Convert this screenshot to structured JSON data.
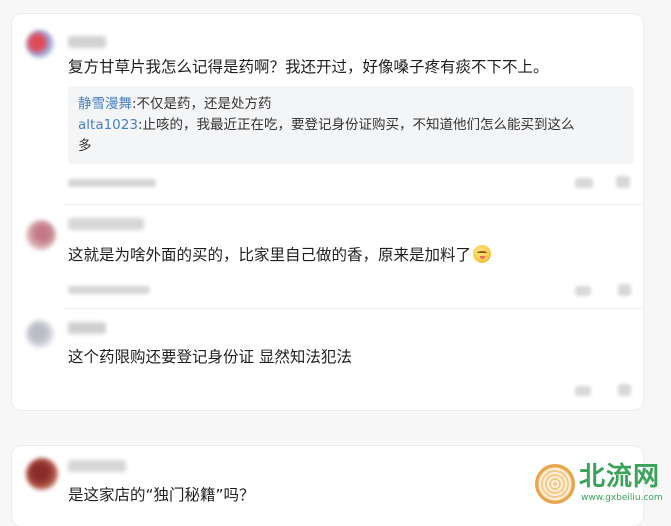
{
  "comments": [
    {
      "text": "复方甘草片我怎么记得是药啊？我还开过，好像嗓子疼有痰不下不上。",
      "replies": [
        {
          "name": "静雪漫舞",
          "text": ":不仅是药，还是处方药"
        },
        {
          "name": "alta1023",
          "text": ":止咳的，我最近正在吃，要登记身份证购买，不知道他们怎么能买到这么"
        },
        {
          "name": "",
          "text": "多"
        }
      ]
    },
    {
      "text": "这就是为啥外面的买的，比家里自己做的香，原来是加料了",
      "emoji_icon": "drooling-face-emoji-icon"
    },
    {
      "text": "这个药限购还要登记身份证 显然知法犯法"
    },
    {
      "text": "是这家店的“独门秘籍”吗？"
    }
  ],
  "watermark": {
    "brand": "北流网",
    "url": "www.gxbeiliu.com"
  },
  "colors": {
    "reply_name": "#4a7fc4",
    "watermark_green": "#3aa35a",
    "watermark_seal": "#e9a44a",
    "card_bg": "#ffffff",
    "quote_bg": "#f4f5f7"
  }
}
